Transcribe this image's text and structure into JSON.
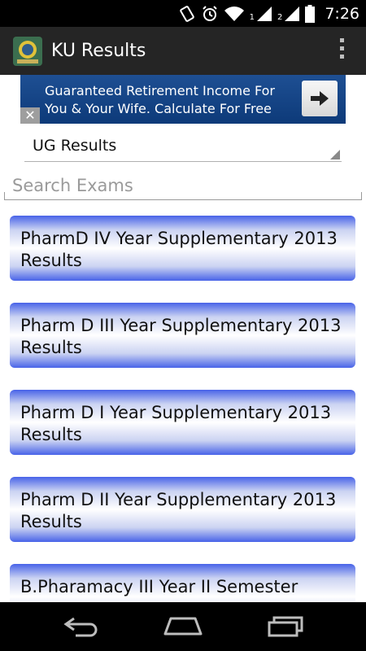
{
  "status_bar": {
    "time": "7:26",
    "sim1_label": "1",
    "sim2_label": "2",
    "icons": [
      "vibrate-icon",
      "alarm-icon",
      "wifi-icon",
      "signal-icon",
      "signal-icon",
      "battery-icon"
    ]
  },
  "action_bar": {
    "title": "KU Results",
    "icons": [
      "app-logo-icon",
      "overflow-menu-icon"
    ]
  },
  "ad": {
    "text": "Guaranteed Retirement Income For\nYou & Your Wife. Calculate For Free",
    "close_glyph": "✕",
    "colors": {
      "background": "#1e4f93"
    }
  },
  "filter": {
    "selected": "UG Results"
  },
  "search": {
    "placeholder": "Search Exams",
    "value": ""
  },
  "results": [
    {
      "label": "PharmD IV Year Supplementary 2013 Results"
    },
    {
      "label": "Pharm D III Year Supplementary 2013 Results"
    },
    {
      "label": "Pharm D I Year Supplementary 2013 Results"
    },
    {
      "label": "Pharm D II Year Supplementary 2013 Results"
    },
    {
      "label": "B.Pharamacy III Year II Semester"
    }
  ],
  "colors": {
    "item_edge": "#4863e8",
    "action_bar": "#252525"
  },
  "nav": {
    "icons": [
      "back-icon",
      "home-icon",
      "recent-apps-icon"
    ]
  }
}
